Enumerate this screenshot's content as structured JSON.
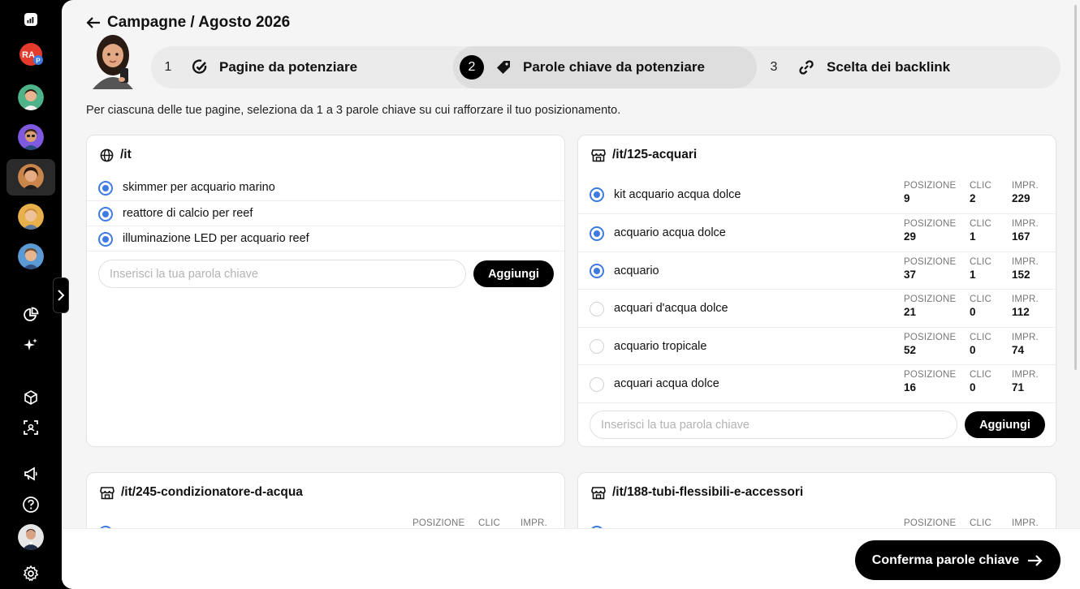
{
  "header": {
    "back_label": "Campagne / Agosto 2026"
  },
  "steps": [
    {
      "number": "1",
      "label": "Pagine da potenziare",
      "icon": "target-check-icon"
    },
    {
      "number": "2",
      "label": "Parole chiave da potenziare",
      "icon": "tag-icon",
      "active": true
    },
    {
      "number": "3",
      "label": "Scelta dei backlink",
      "icon": "link-icon"
    }
  ],
  "intro": "Per ciascuna delle tue pagine, seleziona da 1 a 3 parole chiave su cui rafforzare il tuo posizionamento.",
  "stat_labels": {
    "position": "POSIZIONE",
    "clicks": "CLIC",
    "impressions": "IMPR."
  },
  "add_label": "Aggiungi",
  "input_placeholder": "Inserisci la tua parola chiave",
  "cards": [
    {
      "title": "/it",
      "icon": "globe-icon",
      "keywords": [
        {
          "label": "skimmer per acquario marino",
          "selected": true
        },
        {
          "label": "reattore di calcio per reef",
          "selected": true
        },
        {
          "label": "illuminazione LED per acquario reef",
          "selected": true
        }
      ]
    },
    {
      "title": "/it/125-acquari",
      "icon": "store-icon",
      "keywords": [
        {
          "label": "kit acquario acqua dolce",
          "selected": true,
          "position": "9",
          "clicks": "2",
          "impressions": "229"
        },
        {
          "label": "acquario acqua dolce",
          "selected": true,
          "position": "29",
          "clicks": "1",
          "impressions": "167"
        },
        {
          "label": "acquario",
          "selected": true,
          "position": "37",
          "clicks": "1",
          "impressions": "152"
        },
        {
          "label": "acquari d'acqua dolce",
          "selected": false,
          "position": "21",
          "clicks": "0",
          "impressions": "112"
        },
        {
          "label": "acquario tropicale",
          "selected": false,
          "position": "52",
          "clicks": "0",
          "impressions": "74"
        },
        {
          "label": "acquari acqua dolce",
          "selected": false,
          "position": "16",
          "clicks": "0",
          "impressions": "71"
        }
      ]
    },
    {
      "title": "/it/245-condizionatore-d-acqua",
      "icon": "store-icon"
    },
    {
      "title": "/it/188-tubi-flessibili-e-accessori",
      "icon": "store-icon"
    }
  ],
  "footer": {
    "confirm_label": "Conferma parole chiave"
  },
  "sidebar": {
    "logo_text": "RA",
    "logo_badge": "P"
  },
  "colors": {
    "accent": "#3d7be0",
    "dark": "#000000",
    "panel": "#f5f5f5"
  }
}
